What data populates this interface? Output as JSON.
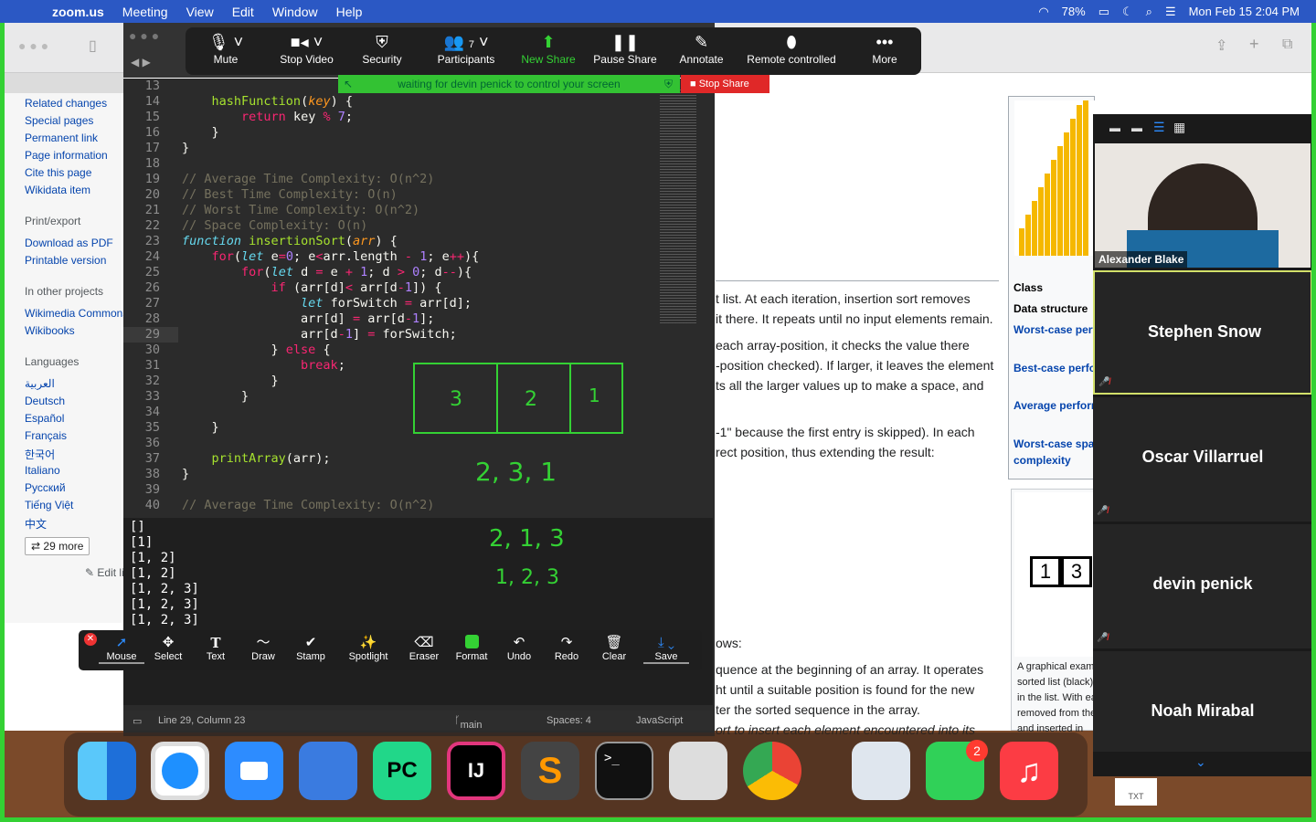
{
  "menubar": {
    "app": "zoom.us",
    "items": [
      "Meeting",
      "View",
      "Edit",
      "Window",
      "Help"
    ],
    "battery": "78%",
    "datetime": "Mon Feb 15  2:04 PM"
  },
  "wiki": {
    "links": [
      "Related changes",
      "Special pages",
      "Permanent link",
      "Page information",
      "Cite this page",
      "Wikidata item"
    ],
    "print_head": "Print/export",
    "print_links": [
      "Download as PDF",
      "Printable version"
    ],
    "proj_head": "In other projects",
    "proj_links": [
      "Wikimedia Commons",
      "Wikibooks"
    ],
    "lang_head": "Languages",
    "langs": [
      "العربية",
      "Deutsch",
      "Español",
      "Français",
      "한국어",
      "Italiano",
      "Русский",
      "Tiếng Việt",
      "中文"
    ],
    "more": "29 more",
    "edit": "Edit links",
    "para": [
      "t list. At each iteration, insertion sort removes",
      "it there. It repeats until no input elements remain.",
      "each array-position, it checks the value there",
      "-position checked). If larger, it leaves the element",
      "ts all the larger values up to make a space, and",
      "-1\" because the first entry is skipped). In each",
      "rect position, thus extending the result:",
      "ows:",
      "quence at the beginning of an array. It operates",
      "ht until a suitable position is found for the new",
      "ter the sorted sequence in the array.",
      "ort to insert each element encountered into its"
    ],
    "infobox": [
      "Class",
      "Data structure",
      "Worst-case performance",
      "Best-case performance",
      "Average performance",
      "Worst-case space",
      "complexity"
    ],
    "fig_caption": [
      "A graphical example",
      "sorted list (black)",
      "in the list. With each",
      "removed from the",
      "and inserted in"
    ],
    "fig_cells": [
      "1",
      "3"
    ]
  },
  "editor": {
    "lines": [
      13,
      14,
      15,
      16,
      17,
      18,
      19,
      20,
      21,
      22,
      23,
      24,
      25,
      26,
      27,
      28,
      29,
      30,
      31,
      32,
      33,
      34,
      35,
      36,
      37,
      38,
      39,
      40
    ],
    "console": [
      "[]",
      "[1]",
      "[1, 2]",
      "[1, 2]",
      "[1, 2, 3]",
      "[1, 2, 3]",
      "[1, 2, 3]"
    ],
    "status": {
      "pos": "Line 29, Column 23",
      "branch": "main",
      "spaces": "Spaces: 4",
      "lang": "JavaScript"
    }
  },
  "zoom": {
    "toolbar": [
      "Mute",
      "Stop Video",
      "Security",
      "Participants",
      "New Share",
      "Pause Share",
      "Annotate",
      "Remote controlled",
      "More"
    ],
    "participants_count": "7",
    "waiting": "waiting for devin penick to control your screen",
    "stop_share": "Stop Share",
    "annotate": [
      "Mouse",
      "Select",
      "Text",
      "Draw",
      "Stamp",
      "Spotlight",
      "Eraser",
      "Format",
      "Undo",
      "Redo",
      "Clear",
      "Save"
    ],
    "participants": [
      "Alexander Blake",
      "Stephen Snow",
      "Oscar Villarruel",
      "devin penick",
      "Noah Mirabal"
    ]
  },
  "handwriting": {
    "boxes": [
      "3",
      "2",
      "1"
    ],
    "row1": "2, 3, 1",
    "row2": "2, 1, 3",
    "row3": "1, 2, 3"
  },
  "dock": {
    "badge": "2",
    "txt": "TXT"
  }
}
